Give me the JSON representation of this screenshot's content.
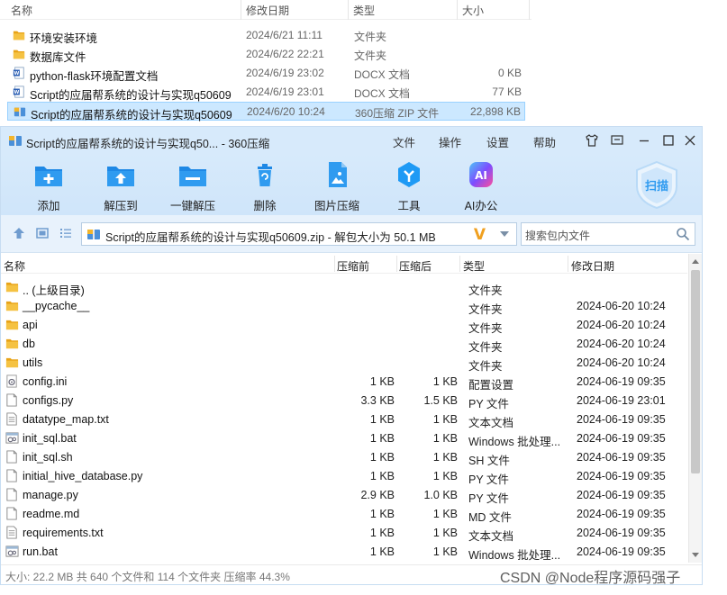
{
  "explorer": {
    "columns": {
      "name": "名称",
      "date": "修改日期",
      "type": "类型",
      "size": "大小"
    },
    "rows": [
      {
        "name": "环境安装环境",
        "date": "2024/6/21 11:11",
        "type": "文件夹",
        "size": "",
        "icon": "folder-icon"
      },
      {
        "name": "数据库文件",
        "date": "2024/6/22 22:21",
        "type": "文件夹",
        "size": "",
        "icon": "folder-icon"
      },
      {
        "name": "python-flask环境配置文档",
        "date": "2024/6/19 23:02",
        "type": "DOCX 文档",
        "size": "0 KB",
        "icon": "word-doc-icon"
      },
      {
        "name": "Script的应届帮系统的设计与实现q50609",
        "date": "2024/6/19 23:01",
        "type": "DOCX 文档",
        "size": "77 KB",
        "icon": "word-doc-icon"
      },
      {
        "name": "Script的应届帮系统的设计与实现q50609",
        "date": "2024/6/20 10:24",
        "type": "360压缩 ZIP 文件",
        "size": "22,898 KB",
        "icon": "zip-archive-icon",
        "selected": true
      }
    ]
  },
  "window": {
    "title": "Script的应届帮系统的设计与实现q50... - 360压缩",
    "menu": [
      "文件",
      "操作",
      "设置",
      "帮助"
    ],
    "toolbar": [
      {
        "label": "添加",
        "icon": "add-icon"
      },
      {
        "label": "解压到",
        "icon": "extract-to-icon"
      },
      {
        "label": "一键解压",
        "icon": "one-click-extract-icon"
      },
      {
        "label": "删除",
        "icon": "delete-icon"
      },
      {
        "label": "图片压缩",
        "icon": "image-compress-icon"
      },
      {
        "label": "工具",
        "icon": "tools-icon"
      },
      {
        "label": "AI办公",
        "icon": "ai-office-icon"
      }
    ],
    "scan_label": "扫描",
    "address": "Script的应届帮系统的设计与实现q50609.zip - 解包大小为 50.1 MB",
    "search_placeholder": "搜索包内文件",
    "list_columns": {
      "name": "名称",
      "compressed_before": "压缩前",
      "compressed_after": "压缩后",
      "type": "类型",
      "date": "修改日期"
    },
    "files": [
      {
        "name": ".. (上级目录)",
        "before": "",
        "after": "",
        "type": "文件夹",
        "date": "",
        "icon": "folder-icon"
      },
      {
        "name": "__pycache__",
        "before": "",
        "after": "",
        "type": "文件夹",
        "date": "2024-06-20 10:24",
        "icon": "folder-icon"
      },
      {
        "name": "api",
        "before": "",
        "after": "",
        "type": "文件夹",
        "date": "2024-06-20 10:24",
        "icon": "folder-icon"
      },
      {
        "name": "db",
        "before": "",
        "after": "",
        "type": "文件夹",
        "date": "2024-06-20 10:24",
        "icon": "folder-icon"
      },
      {
        "name": "utils",
        "before": "",
        "after": "",
        "type": "文件夹",
        "date": "2024-06-20 10:24",
        "icon": "folder-icon"
      },
      {
        "name": "config.ini",
        "before": "1 KB",
        "after": "1 KB",
        "type": "配置设置",
        "date": "2024-06-19 09:35",
        "icon": "config-file-icon"
      },
      {
        "name": "configs.py",
        "before": "3.3 KB",
        "after": "1.5 KB",
        "type": "PY 文件",
        "date": "2024-06-19 23:01",
        "icon": "file-icon"
      },
      {
        "name": "datatype_map.txt",
        "before": "1 KB",
        "after": "1 KB",
        "type": "文本文档",
        "date": "2024-06-19 09:35",
        "icon": "text-file-icon"
      },
      {
        "name": "init_sql.bat",
        "before": "1 KB",
        "after": "1 KB",
        "type": "Windows 批处理...",
        "date": "2024-06-19 09:35",
        "icon": "batch-file-icon"
      },
      {
        "name": "init_sql.sh",
        "before": "1 KB",
        "after": "1 KB",
        "type": "SH 文件",
        "date": "2024-06-19 09:35",
        "icon": "file-icon"
      },
      {
        "name": "initial_hive_database.py",
        "before": "1 KB",
        "after": "1 KB",
        "type": "PY 文件",
        "date": "2024-06-19 09:35",
        "icon": "file-icon"
      },
      {
        "name": "manage.py",
        "before": "2.9 KB",
        "after": "1.0 KB",
        "type": "PY 文件",
        "date": "2024-06-19 09:35",
        "icon": "file-icon"
      },
      {
        "name": "readme.md",
        "before": "1 KB",
        "after": "1 KB",
        "type": "MD 文件",
        "date": "2024-06-19 09:35",
        "icon": "file-icon"
      },
      {
        "name": "requirements.txt",
        "before": "1 KB",
        "after": "1 KB",
        "type": "文本文档",
        "date": "2024-06-19 09:35",
        "icon": "text-file-icon"
      },
      {
        "name": "run.bat",
        "before": "1 KB",
        "after": "1 KB",
        "type": "Windows 批处理...",
        "date": "2024-06-19 09:35",
        "icon": "batch-file-icon"
      }
    ],
    "status": "大小: 22.2 MB 共 640 个文件和 114 个文件夹 压缩率 44.3%"
  },
  "watermark": "CSDN @Node程序源码强子",
  "colors": {
    "accent": "#1e88e5",
    "titlebar": "#d7eafb",
    "folder": "#f2b52b",
    "selection": "#cce8ff"
  }
}
